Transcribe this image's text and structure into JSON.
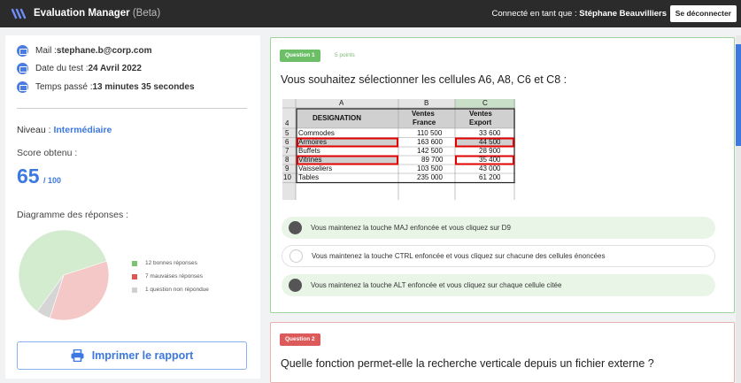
{
  "header": {
    "app_title": "Evaluation Manager",
    "beta": "(Beta)",
    "connected_prefix": "Connecté en tant que : ",
    "user_name": "Stéphane Beauvilliers",
    "logout_label": "Se déconnecter"
  },
  "sidebar": {
    "mail_label": "Mail : ",
    "mail_value": "stephane.b@corp.com",
    "date_label": "Date du test : ",
    "date_value": "24 Avril 2022",
    "time_label": "Temps passé : ",
    "time_value": "13 minutes 35 secondes",
    "level_label": "Niveau : ",
    "level_value": "Intermédiaire",
    "score_label": "Score obtenu  :",
    "score_value": "65",
    "score_total": "/ 100",
    "diagram_label": "Diagramme des réponses :",
    "print_label": "Imprimer le rapport"
  },
  "chart_data": {
    "type": "pie",
    "title": "",
    "slices": [
      {
        "label": "12 bonnes réponses",
        "value": 12,
        "color": "#d3eccf"
      },
      {
        "label": "7 mauvaises réponses",
        "value": 7,
        "color": "#f5c8c8"
      },
      {
        "label": "1 question non répondue",
        "value": 1,
        "color": "#d5d5d5"
      }
    ],
    "legend_colors": [
      "#7ac472",
      "#e05555",
      "#cfcfcf"
    ],
    "legend_position": "right"
  },
  "question1": {
    "badge": "Question 1",
    "points": "5 points",
    "title": "Vous souhaitez sélectionner les cellules A6, A8, C6 et C8 :",
    "sheet": {
      "col_headers": [
        "A",
        "B",
        "C"
      ],
      "row_numbers": [
        "4",
        "5",
        "6",
        "7",
        "8",
        "9",
        "10"
      ],
      "header_cells": [
        "DESIGNATION",
        "Ventes",
        "France",
        "Ventes",
        "Export"
      ],
      "rows": [
        [
          "Commodes",
          "110 500",
          "33 600"
        ],
        [
          "Armoires",
          "163 600",
          "44 500"
        ],
        [
          "Buffets",
          "142 500",
          "28 900"
        ],
        [
          "Vitrines",
          "89 700",
          "35 400"
        ],
        [
          "Vaisseliers",
          "103 500",
          "43 000"
        ],
        [
          "Tables",
          "235 000",
          "61 200"
        ]
      ]
    },
    "options": [
      {
        "text": "Vous maintenez la touche MAJ enfoncée et vous cliquez sur D9",
        "selected": true
      },
      {
        "text": "Vous maintenez la touche CTRL enfoncée et vous cliquez sur chacune des cellules énoncées",
        "selected": false
      },
      {
        "text": "Vous maintenez la touche ALT enfoncée et vous cliquez sur chaque cellule citée",
        "selected": true
      }
    ]
  },
  "question2": {
    "badge": "Question 2",
    "title": "Quelle fonction permet-elle la recherche verticale depuis un fichier externe ?"
  }
}
